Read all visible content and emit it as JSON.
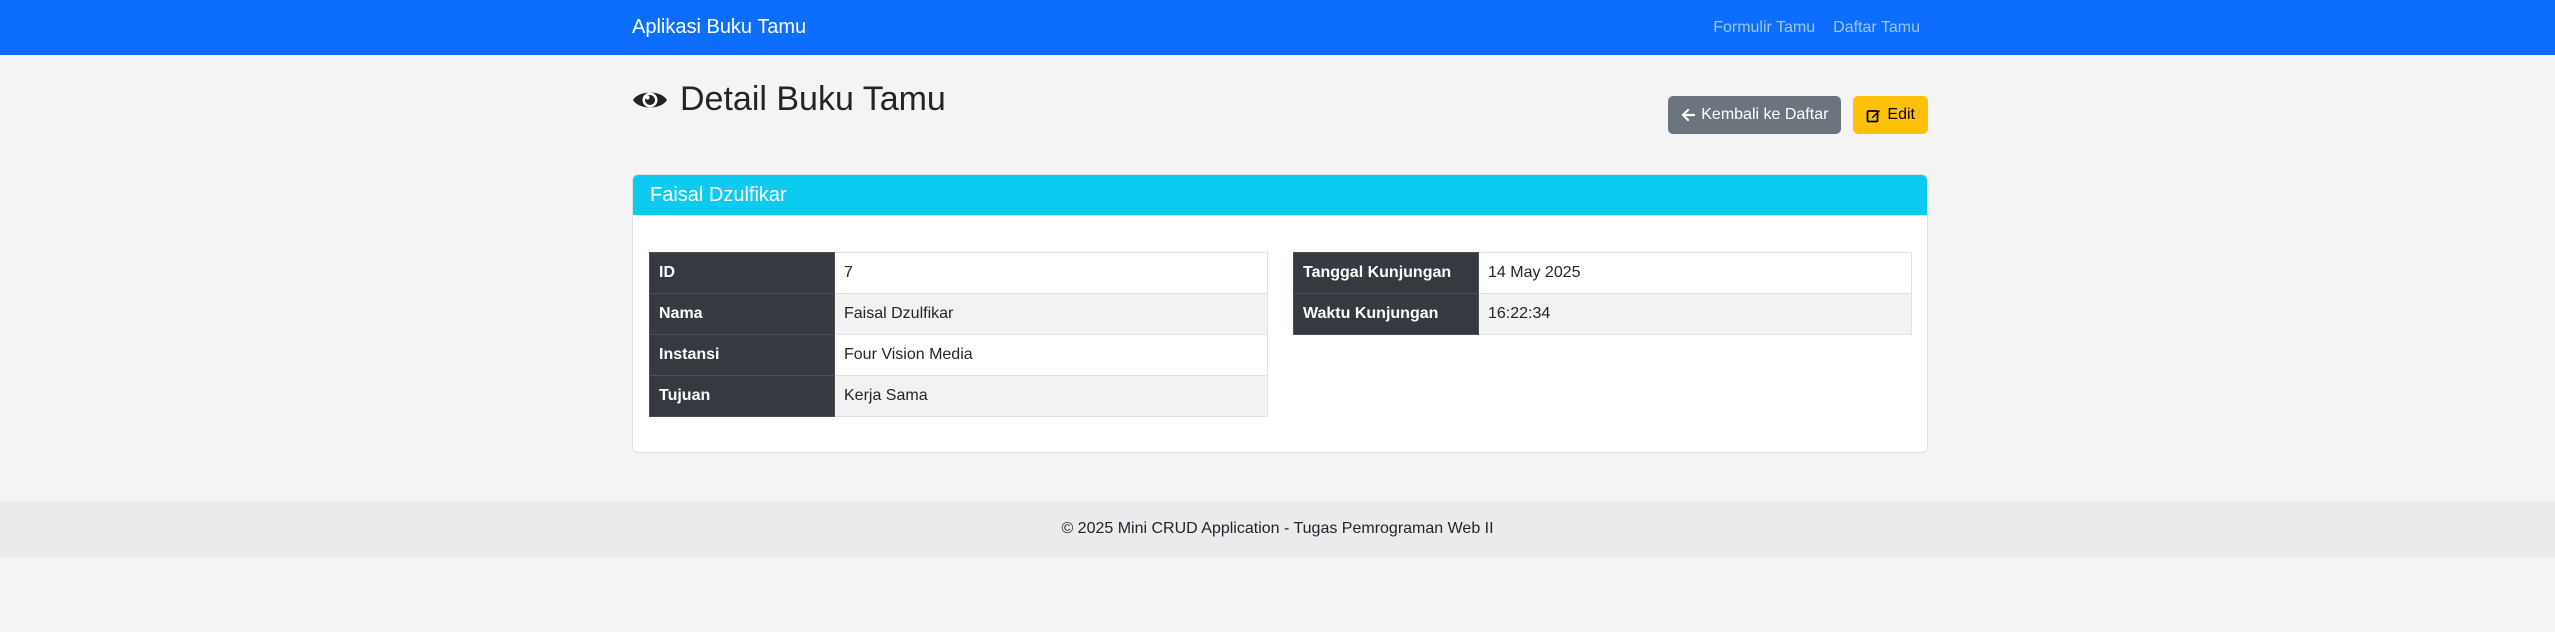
{
  "navbar": {
    "brand": "Aplikasi Buku Tamu",
    "links": [
      "Formulir Tamu",
      "Daftar Tamu"
    ]
  },
  "page": {
    "title": "Detail Buku Tamu",
    "title_icon": "eye-icon"
  },
  "actions": {
    "back_label": "Kembali ke Daftar",
    "back_icon": "arrow-left-icon",
    "edit_label": "Edit",
    "edit_icon": "edit-icon"
  },
  "card": {
    "header": "Faisal Dzulfikar",
    "left_rows": [
      {
        "label": "ID",
        "value": "7"
      },
      {
        "label": "Nama",
        "value": "Faisal Dzulfikar"
      },
      {
        "label": "Instansi",
        "value": "Four Vision Media"
      },
      {
        "label": "Tujuan",
        "value": "Kerja Sama"
      }
    ],
    "right_rows": [
      {
        "label": "Tanggal Kunjungan",
        "value": "14 May 2025"
      },
      {
        "label": "Waktu Kunjungan",
        "value": "16:22:34"
      }
    ]
  },
  "footer": {
    "text": "© 2025 Mini CRUD Application - Tugas Pemrograman Web II"
  },
  "colors": {
    "navbar": "#0d6efd",
    "card_header": "#0dcaf0",
    "button_secondary": "#6c757d",
    "button_warning": "#ffc107",
    "table_key_bg": "#343a40"
  }
}
